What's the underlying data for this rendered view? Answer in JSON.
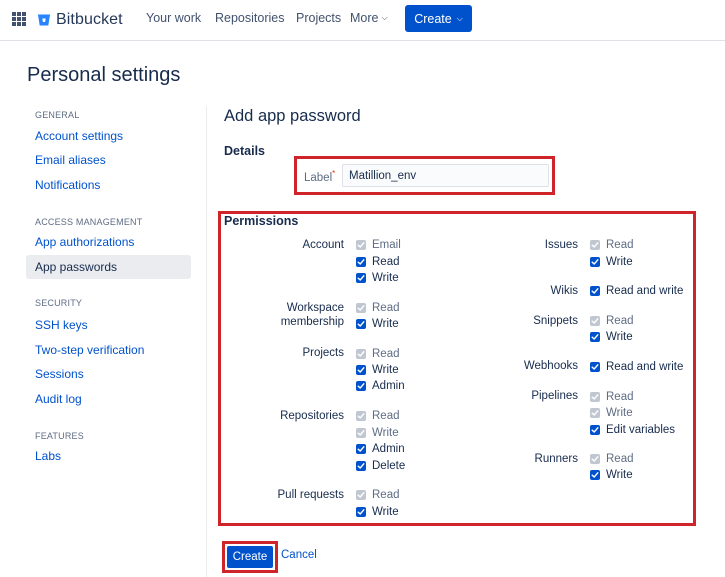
{
  "topnav": {
    "logo": "Bitbucket",
    "items": [
      "Your work",
      "Repositories",
      "Projects",
      "More"
    ],
    "create_label": "Create"
  },
  "page_title": "Personal settings",
  "sidebar": {
    "general_heading": "GENERAL",
    "general_items": [
      "Account settings",
      "Email aliases",
      "Notifications"
    ],
    "access_heading": "ACCESS MANAGEMENT",
    "access_items": [
      "App authorizations",
      "App passwords"
    ],
    "security_heading": "SECURITY",
    "security_items": [
      "SSH keys",
      "Two-step verification",
      "Sessions",
      "Audit log"
    ],
    "features_heading": "FEATURES",
    "features_items": [
      "Labs"
    ],
    "selected": "App passwords"
  },
  "main": {
    "title": "Add app password",
    "details_heading": "Details",
    "label_field": {
      "label": "Label",
      "required_mark": "*",
      "value": "Matillion_env"
    },
    "permissions_heading": "Permissions",
    "groups": {
      "account": {
        "label": "Account",
        "options": [
          {
            "text": "Email",
            "checked": false
          },
          {
            "text": "Read",
            "checked": true
          },
          {
            "text": "Write",
            "checked": true
          }
        ]
      },
      "workspace": {
        "label_line1": "Workspace",
        "label_line2": "membership",
        "options": [
          {
            "text": "Read",
            "checked": false
          },
          {
            "text": "Write",
            "checked": true
          }
        ]
      },
      "projects": {
        "label": "Projects",
        "options": [
          {
            "text": "Read",
            "checked": false
          },
          {
            "text": "Write",
            "checked": true
          },
          {
            "text": "Admin",
            "checked": true
          }
        ]
      },
      "repositories": {
        "label": "Repositories",
        "options": [
          {
            "text": "Read",
            "checked": false
          },
          {
            "text": "Write",
            "checked": false
          },
          {
            "text": "Admin",
            "checked": true
          },
          {
            "text": "Delete",
            "checked": true
          }
        ]
      },
      "pull_requests": {
        "label": "Pull requests",
        "options": [
          {
            "text": "Read",
            "checked": false
          },
          {
            "text": "Write",
            "checked": true
          }
        ]
      },
      "issues": {
        "label": "Issues",
        "options": [
          {
            "text": "Read",
            "checked": false
          },
          {
            "text": "Write",
            "checked": true
          }
        ]
      },
      "wikis": {
        "label": "Wikis",
        "options": [
          {
            "text": "Read and write",
            "checked": true
          }
        ]
      },
      "snippets": {
        "label": "Snippets",
        "options": [
          {
            "text": "Read",
            "checked": false
          },
          {
            "text": "Write",
            "checked": true
          }
        ]
      },
      "webhooks": {
        "label": "Webhooks",
        "options": [
          {
            "text": "Read and write",
            "checked": true
          }
        ]
      },
      "pipelines": {
        "label": "Pipelines",
        "options": [
          {
            "text": "Read",
            "checked": false
          },
          {
            "text": "Write",
            "checked": false
          },
          {
            "text": "Edit variables",
            "checked": true
          }
        ]
      },
      "runners": {
        "label": "Runners",
        "options": [
          {
            "text": "Read",
            "checked": false
          },
          {
            "text": "Write",
            "checked": true
          }
        ]
      }
    },
    "create_label": "Create",
    "cancel_label": "Cancel"
  },
  "colors": {
    "primary": "#0052cc",
    "highlight": "#d0242b",
    "text": "#172b4d",
    "disabled": "#c1c7d0"
  }
}
